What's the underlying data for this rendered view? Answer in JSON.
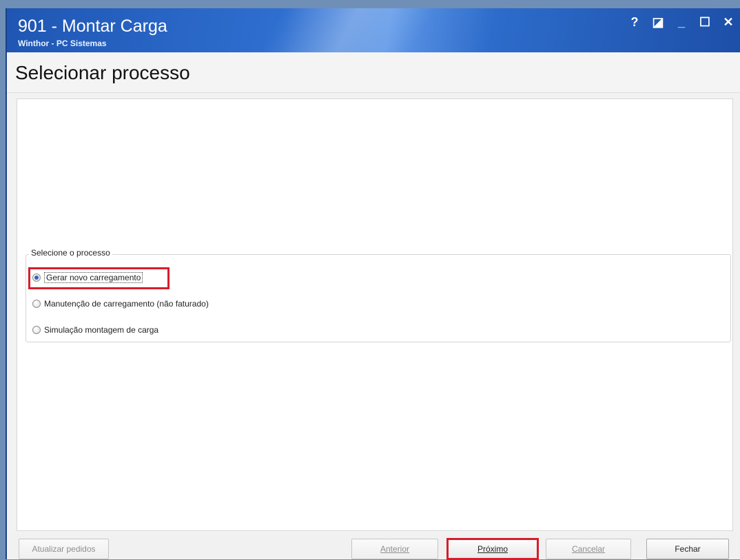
{
  "window": {
    "title": "901 - Montar Carga",
    "subtitle": "Winthor - PC Sistemas",
    "controls": {
      "help": "?",
      "restore": "◪",
      "minimize": "_",
      "maximize": "☐",
      "close": "✕"
    }
  },
  "page": {
    "title": "Selecionar processo"
  },
  "process_group": {
    "label": "Selecione o processo",
    "options": [
      {
        "label": "Gerar novo carregamento",
        "selected": true
      },
      {
        "label": "Manutenção de carregamento (não faturado)",
        "selected": false
      },
      {
        "label": "Simulação montagem de carga",
        "selected": false
      }
    ]
  },
  "footer": {
    "buttons": [
      {
        "label": "Atualizar pedidos",
        "enabled": false
      },
      {
        "label": "Anterior",
        "enabled": false
      },
      {
        "label": "Próximo",
        "enabled": true
      },
      {
        "label": "Cancelar",
        "enabled": false
      },
      {
        "label": "Fechar",
        "enabled": true
      }
    ]
  },
  "colors": {
    "titlebar": "#1f56b3",
    "highlight": "#d61d2b"
  }
}
